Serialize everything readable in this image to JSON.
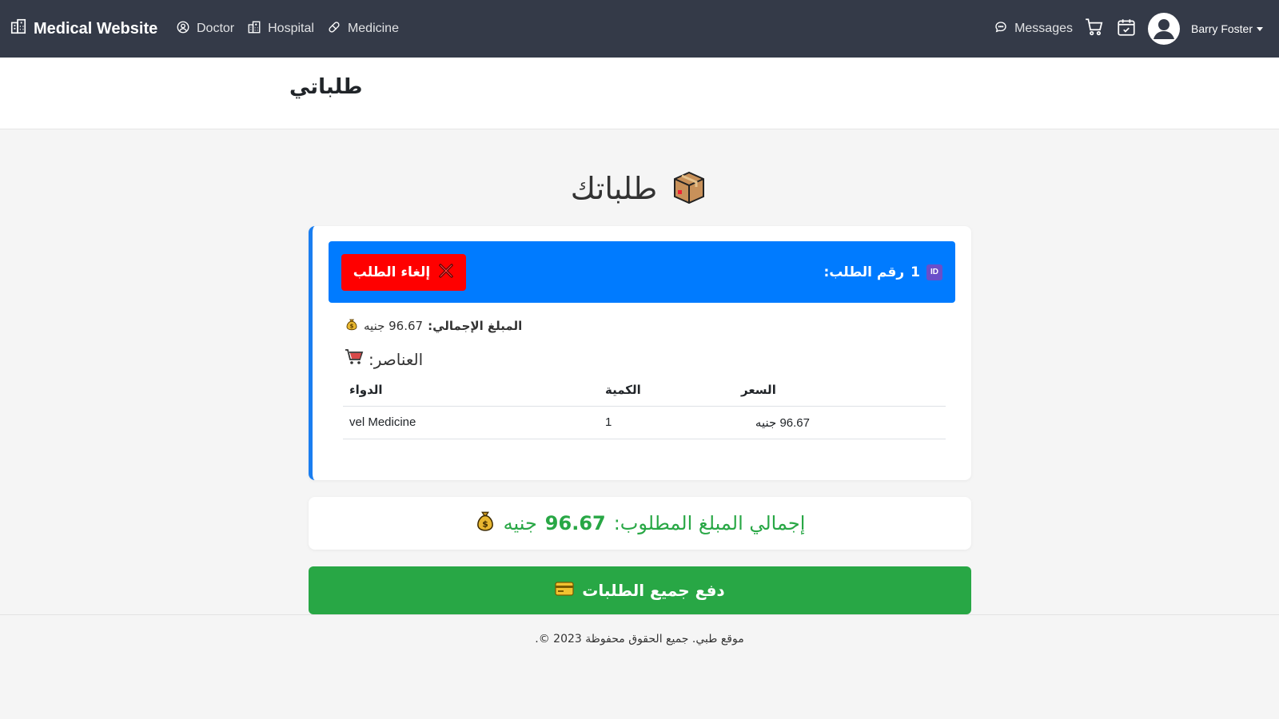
{
  "navbar": {
    "brand": "Medical Website",
    "links": [
      {
        "label": "Doctor",
        "icon": "user-circle-icon"
      },
      {
        "label": "Hospital",
        "icon": "hospital-icon"
      },
      {
        "label": "Medicine",
        "icon": "pill-icon"
      }
    ],
    "messages_label": "Messages",
    "user_name": "Barry Foster"
  },
  "header": {
    "title": "طلباتي"
  },
  "main": {
    "title": "طلباتك",
    "order": {
      "id_label": "رقم الطلب:",
      "id_value": "1",
      "cancel_label": "إلغاء الطلب",
      "total_label": "المبلغ الإجمالي:",
      "total_value": "96.67 جنيه",
      "items_title": ":العناصر",
      "table": {
        "headers": [
          "الدواء",
          "الكمية",
          "السعر"
        ],
        "rows": [
          [
            "vel Medicine",
            "1",
            "96.67 جنيه"
          ]
        ]
      }
    },
    "grand_total": {
      "label": "إجمالي المبلغ المطلوب:",
      "value": "96.67",
      "currency": "جنيه"
    },
    "pay_label": "دفع جميع الطلبات"
  },
  "footer": {
    "text": "موقع طبي. جميع الحقوق محفوظة 2023 ©."
  },
  "colors": {
    "navbar": "#343a48",
    "primary": "#007bff",
    "danger": "#ff0000",
    "success": "#28a745"
  }
}
